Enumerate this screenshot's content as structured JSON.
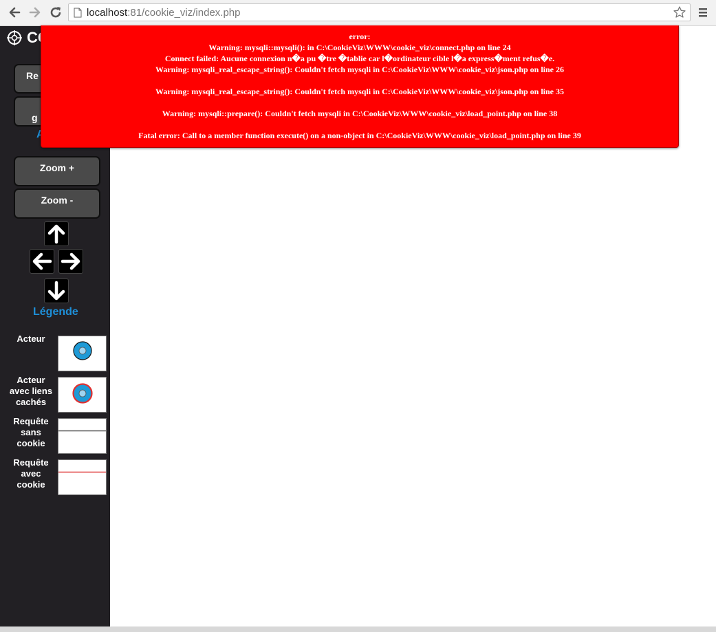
{
  "browser": {
    "url_host": "localhost",
    "url_rest": ":81/cookie_viz/index.php"
  },
  "app": {
    "logo_text": "CO",
    "button1_label": "Re g",
    "button2_label": "g",
    "link_partial": "A",
    "zoom_in_label": "Zoom +",
    "zoom_out_label": "Zoom -",
    "legend_title": "Légende",
    "legend": [
      {
        "label": "Acteur"
      },
      {
        "label": "Acteur avec liens cachés"
      },
      {
        "label": "Requête sans cookie"
      },
      {
        "label": "Requête avec cookie"
      }
    ],
    "colors": {
      "actor_fill": "#1e9ad6",
      "hidden_link_ring": "#e03030",
      "request_no_cookie": "#555555",
      "request_with_cookie": "#e04040"
    }
  },
  "error": {
    "title": "error:",
    "lines": [
      "Warning: mysqli::mysqli(): in C:\\CookieViz\\WWW\\cookie_viz\\connect.php on line 24",
      "Connect failed: Aucune connexion n�a pu �tre �tablie car l�ordinateur cible l�a express�ment refus�e.",
      "Warning: mysqli_real_escape_string(): Couldn't fetch mysqli in C:\\CookieViz\\WWW\\cookie_viz\\json.php on line 26",
      "Warning: mysqli_real_escape_string(): Couldn't fetch mysqli in C:\\CookieViz\\WWW\\cookie_viz\\json.php on line 35",
      "Warning: mysqli::prepare(): Couldn't fetch mysqli in C:\\CookieViz\\WWW\\cookie_viz\\load_point.php on line 38",
      "Fatal error: Call to a member function execute() on a non-object in C:\\CookieViz\\WWW\\cookie_viz\\load_point.php on line 39"
    ]
  }
}
